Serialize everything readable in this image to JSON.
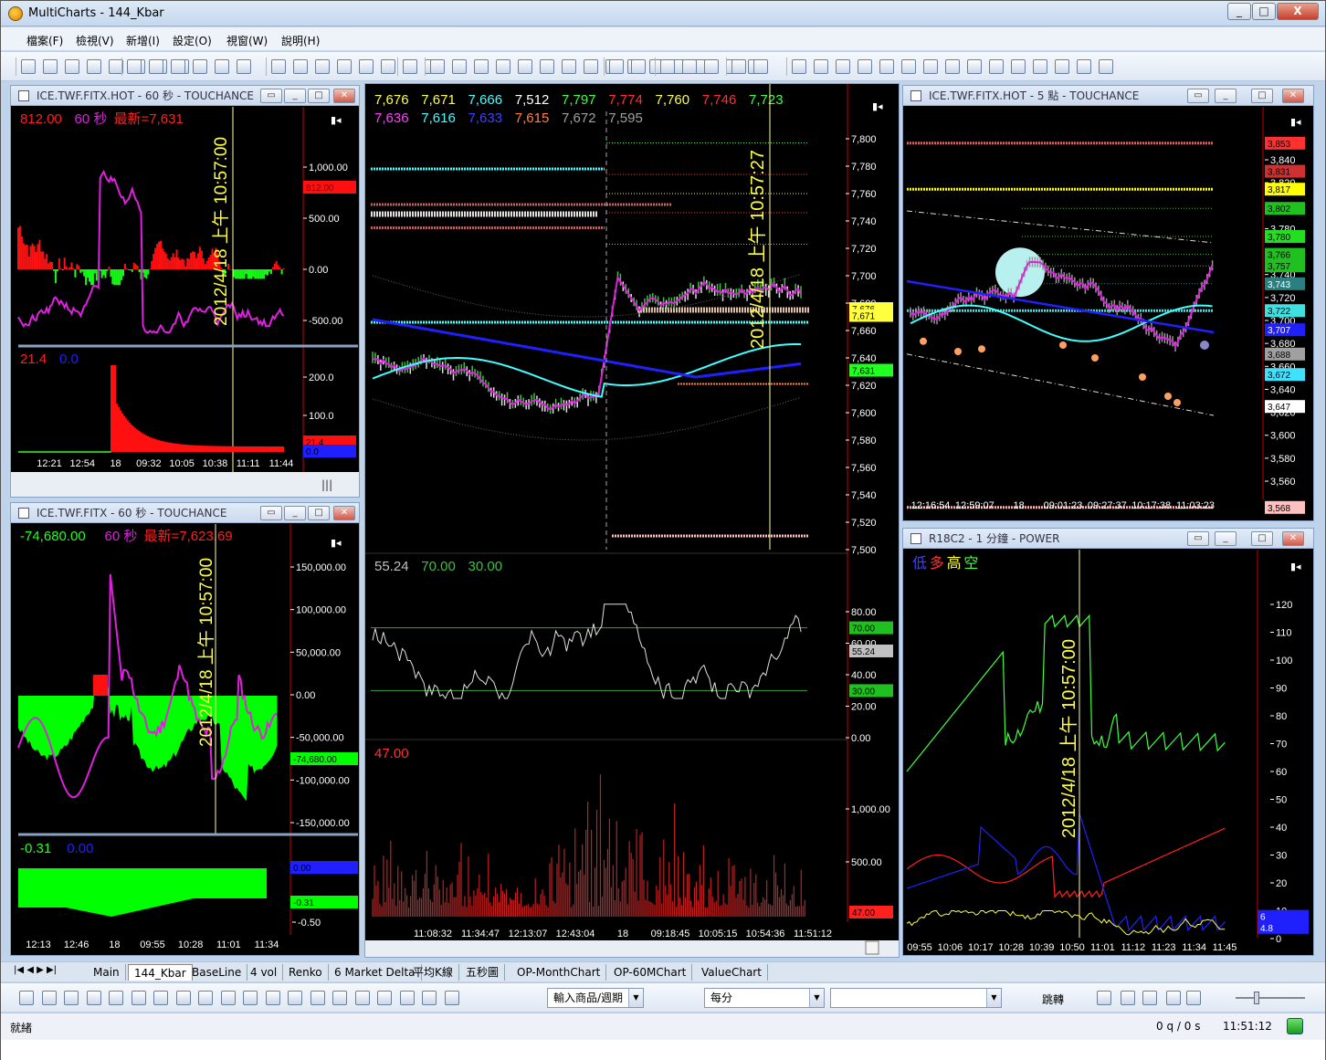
{
  "app": {
    "title": "MultiCharts - 144_Kbar",
    "min": "_",
    "max": "□",
    "close": "X"
  },
  "menu": [
    "檔案(F)",
    "檢視(V)",
    "新增(I)",
    "設定(O)",
    "視窗(W)",
    "說明(H)"
  ],
  "windows": {
    "w1": {
      "title": "ICE.TWF.FITX.HOT - 60 秒 - TOUCHANCE",
      "legend": [
        {
          "t": "812.00",
          "c": "#ff2020"
        },
        {
          "t": "60 秒",
          "c": "#e020e0"
        },
        {
          "t": "最新=7,631",
          "c": "#ff2020"
        }
      ],
      "axis": [
        "1,000.00",
        "500.00",
        "0.00",
        "-500.00"
      ],
      "tag": "812.00",
      "date": "2012/4/18 上午 10:57:00",
      "sub_legend": [
        {
          "t": "21.4",
          "c": "#ff2020"
        },
        {
          "t": "0.0",
          "c": "#2020ff"
        }
      ],
      "sub_axis": [
        "200.0",
        "100.0"
      ],
      "sub_tags": [
        "21.4",
        "0.0"
      ],
      "time": [
        "12:21",
        "12:54",
        "18",
        "09:32",
        "10:05",
        "10:38",
        "11:11",
        "11:44"
      ]
    },
    "w2": {
      "title": "ICE.TWF.FITX - 60 秒 - TOUCHANCE",
      "legend": [
        {
          "t": "-74,680.00",
          "c": "#20ff20"
        },
        {
          "t": "60 秒",
          "c": "#e020e0"
        },
        {
          "t": "最新=7,623.69",
          "c": "#ff2020"
        }
      ],
      "axis": [
        "150,000.00",
        "100,000.00",
        "50,000.00",
        "0.00",
        "-50,000.00",
        "-100,000.00",
        "-150,000.00"
      ],
      "tag": "-74,680.00",
      "date": "2012/4/18 上午 10:57:00",
      "sub_legend": [
        {
          "t": "-0.31",
          "c": "#20ff20"
        },
        {
          "t": "0.00",
          "c": "#2020ff"
        }
      ],
      "sub_axis": [
        "-0.50"
      ],
      "sub_tags": [
        "0.00",
        "-0.31"
      ],
      "time": [
        "12:13",
        "12:46",
        "18",
        "09:55",
        "10:28",
        "11:01",
        "11:34"
      ]
    },
    "main": {
      "legend1": [
        {
          "t": "7,676",
          "c": "#ffff40"
        },
        {
          "t": "7,671",
          "c": "#ffff40"
        },
        {
          "t": "7,666",
          "c": "#40ffff"
        },
        {
          "t": "7,512",
          "c": "#ffffff"
        },
        {
          "t": "7,797",
          "c": "#40ff40"
        },
        {
          "t": "7,774",
          "c": "#ff3030"
        },
        {
          "t": "7,760",
          "c": "#ffff40"
        },
        {
          "t": "7,746",
          "c": "#ff3030"
        },
        {
          "t": "7,723",
          "c": "#40ff40"
        }
      ],
      "legend2": [
        {
          "t": "7,636",
          "c": "#ff40ff"
        },
        {
          "t": "7,616",
          "c": "#40ffff"
        },
        {
          "t": "7,633",
          "c": "#4040ff"
        },
        {
          "t": "7,615",
          "c": "#ff8040"
        },
        {
          "t": "7,672",
          "c": "#a0a0a0"
        },
        {
          "t": "7,595",
          "c": "#a0a0a0"
        }
      ],
      "axis": [
        "7,800",
        "7,780",
        "7,760",
        "7,740",
        "7,720",
        "7,700",
        "7,680",
        "7,660",
        "7,640",
        "7,620",
        "7,600",
        "7,580",
        "7,560",
        "7,540",
        "7,520",
        "7,500"
      ],
      "tags": [
        "7,676",
        "7,671",
        "7,631"
      ],
      "date": "2012/4/18 上午 10:57:27",
      "rsi_legend": [
        {
          "t": "55.24",
          "c": "#c0c0c0"
        },
        {
          "t": "70.00",
          "c": "#40c040"
        },
        {
          "t": "30.00",
          "c": "#40c040"
        }
      ],
      "rsi_axis": [
        "80.00",
        "60.00",
        "40.00",
        "20.00",
        "0.00"
      ],
      "rsi_tags": [
        "70.00",
        "55.24",
        "30.00"
      ],
      "vol_legend": [
        {
          "t": "47.00",
          "c": "#ff3030"
        }
      ],
      "vol_axis": [
        "1,000.00",
        "500.00"
      ],
      "vol_tag": "47.00",
      "time": [
        "11:08:32",
        "11:34:47",
        "12:13:07",
        "12:43:04",
        "18",
        "09:18:45",
        "10:05:15",
        "10:54:36",
        "11:51:12"
      ]
    },
    "w3": {
      "title": "ICE.TWF.FITX.HOT - 5 點 - TOUCHANCE",
      "axis": [
        "3,840",
        "3,820",
        "3,800",
        "3,780",
        "3,760",
        "3,740",
        "3,720",
        "3,700",
        "3,680",
        "3,660",
        "3,640",
        "3,620",
        "3,600",
        "3,580",
        "3,560"
      ],
      "tags": [
        {
          "t": "3,853",
          "c": "#ff3030"
        },
        {
          "t": "3,831",
          "c": "#d03030"
        },
        {
          "t": "3,817",
          "c": "#ffff00"
        },
        {
          "t": "3,802",
          "c": "#20c020"
        },
        {
          "t": "3,780",
          "c": "#20e020"
        },
        {
          "t": "3,766",
          "c": "#20c020"
        },
        {
          "t": "3,757",
          "c": "#20c020"
        },
        {
          "t": "3,743",
          "c": "#2a8080"
        },
        {
          "t": "3,722",
          "c": "#40e0e0"
        },
        {
          "t": "3,707",
          "c": "#2020ff"
        },
        {
          "t": "3,688",
          "c": "#a0a0a0"
        },
        {
          "t": "3,672",
          "c": "#40e0ff"
        },
        {
          "t": "3,647",
          "c": "#ffffff"
        },
        {
          "t": "3,568",
          "c": "#ffc0c0"
        }
      ],
      "time": [
        "12:16:54",
        "12:59:07",
        "18",
        "09:01:23",
        "09:27:37",
        "10:17:38",
        "11:03:23"
      ]
    },
    "w4": {
      "title": "R18C2 - 1 分鐘 - POWER",
      "legend": [
        {
          "t": "低",
          "c": "#4040ff"
        },
        {
          "t": "多",
          "c": "#ff3030"
        },
        {
          "t": "高",
          "c": "#ffff40"
        },
        {
          "t": "空",
          "c": "#40ff40"
        }
      ],
      "axis": [
        "120",
        "110",
        "100",
        "90",
        "80",
        "70",
        "60",
        "50",
        "40",
        "30",
        "20",
        "10",
        "0"
      ],
      "tags": [
        {
          "t": "6",
          "c": "#2020ff"
        },
        {
          "t": "4.8",
          "c": "#2020ff"
        }
      ],
      "date": "2012/4/18 上午 10:57:00",
      "time": [
        "09:55",
        "10:06",
        "10:17",
        "10:28",
        "10:39",
        "10:50",
        "11:01",
        "11:12",
        "11:23",
        "11:34",
        "11:45"
      ]
    }
  },
  "tabs": [
    "Main",
    "144_Kbar",
    "BaseLine",
    "4 vol",
    "Renko",
    "6 Market Delta",
    "平均K線",
    "五秒圖",
    "OP-MonthChart",
    "OP-60MChart",
    "ValueChart"
  ],
  "drawbar": {
    "symbol_combo": "輸入商品/週期",
    "period_combo": "每分",
    "jump": "跳轉"
  },
  "status": {
    "left": "就緒",
    "qs": "0 q / 0 s",
    "time": "11:51:12"
  }
}
